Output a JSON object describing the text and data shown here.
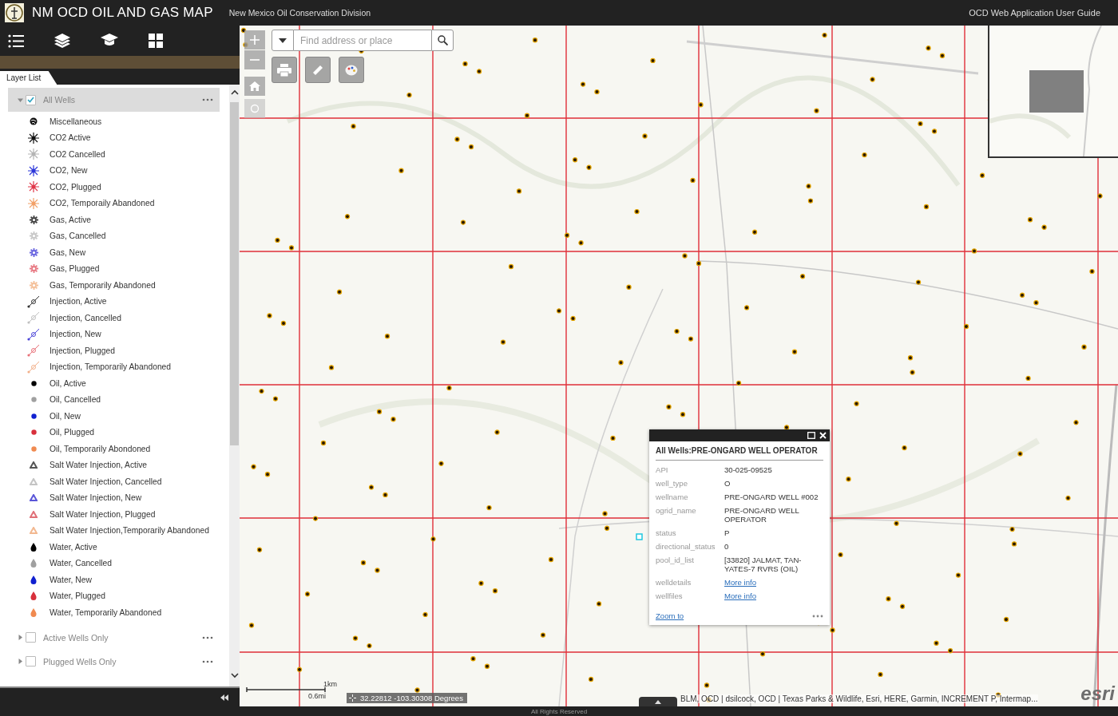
{
  "header": {
    "title": "NM OCD OIL AND GAS MAP",
    "subtitle": "New Mexico Oil Conservation Division",
    "guide_link": "OCD Web Application User Guide"
  },
  "panel": {
    "tab": "Layer List",
    "groups": [
      {
        "label": "All Wells",
        "checked": true,
        "expanded": true,
        "selected": true,
        "legend": [
          {
            "label": "Miscellaneous",
            "kind": "misc",
            "color": "#111111"
          },
          {
            "label": "CO2 Active",
            "kind": "co2",
            "color": "#111111"
          },
          {
            "label": "CO2 Cancelled",
            "kind": "co2",
            "color": "#b4b4b4"
          },
          {
            "label": "CO2, New",
            "kind": "co2",
            "color": "#2b36d9"
          },
          {
            "label": "CO2, Plugged",
            "kind": "co2",
            "color": "#e0384a"
          },
          {
            "label": "CO2, Temporaily Abandoned",
            "kind": "co2",
            "color": "#f2a067"
          },
          {
            "label": "Gas, Active",
            "kind": "gas",
            "color": "#444444"
          },
          {
            "label": "Gas, Cancelled",
            "kind": "gas",
            "color": "#c8c8c8"
          },
          {
            "label": "Gas, New",
            "kind": "gas",
            "color": "#6a66e0"
          },
          {
            "label": "Gas, Plugged",
            "kind": "gas",
            "color": "#e87a84"
          },
          {
            "label": "Gas, Temporarily Abandoned",
            "kind": "gas",
            "color": "#f4c09a"
          },
          {
            "label": "Injection, Active",
            "kind": "injection",
            "color": "#333333"
          },
          {
            "label": "Injection, Cancelled",
            "kind": "injection",
            "color": "#c0c0c0"
          },
          {
            "label": "Injection, New",
            "kind": "injection",
            "color": "#4a44d8"
          },
          {
            "label": "Injection, Plugged",
            "kind": "injection",
            "color": "#e87078"
          },
          {
            "label": "Injection, Temporarily Abandoned",
            "kind": "injection",
            "color": "#f2b08a"
          },
          {
            "label": "Oil, Active",
            "kind": "oil",
            "color": "#000000"
          },
          {
            "label": "Oil, Cancelled",
            "kind": "oil",
            "color": "#a0a0a0"
          },
          {
            "label": "Oil, New",
            "kind": "oil",
            "color": "#1020d0"
          },
          {
            "label": "Oil, Plugged",
            "kind": "oil",
            "color": "#d8303c"
          },
          {
            "label": "Oil, Temporarily Abondoned",
            "kind": "oil",
            "color": "#f08a50"
          },
          {
            "label": "Salt Water Injection, Active",
            "kind": "swi",
            "color": "#555555"
          },
          {
            "label": "Salt Water Injection, Cancelled",
            "kind": "swi",
            "color": "#c4c4c4"
          },
          {
            "label": "Salt Water Injection, New",
            "kind": "swi",
            "color": "#5a56d8"
          },
          {
            "label": "Salt Water Injection, Plugged",
            "kind": "swi",
            "color": "#e07078"
          },
          {
            "label": "Salt Water Injection,Temporarily Abandoned",
            "kind": "swi",
            "color": "#f2b890"
          },
          {
            "label": "Water, Active",
            "kind": "water",
            "color": "#000000"
          },
          {
            "label": "Water, Cancelled",
            "kind": "water",
            "color": "#a0a0a0"
          },
          {
            "label": "Water, New",
            "kind": "water",
            "color": "#1020d0"
          },
          {
            "label": "Water, Plugged",
            "kind": "water",
            "color": "#d8303c"
          },
          {
            "label": "Water, Temporarily Abandoned",
            "kind": "water",
            "color": "#f08a50"
          }
        ]
      },
      {
        "label": "Active Wells Only",
        "checked": false,
        "expanded": false,
        "selected": false
      },
      {
        "label": "Plugged Wells Only",
        "checked": false,
        "expanded": false,
        "selected": false
      }
    ]
  },
  "map": {
    "search": {
      "placeholder": "Find address or place"
    },
    "scale": {
      "metric": "1km",
      "imperial": "0.6mi"
    },
    "coordinates": "32.22812 -103.30308 Degrees",
    "attribution": "BLM, OCD | dsilcock, OCD | Texas Parks & Wildlife, Esri, HERE, Garmin, INCREMENT P, Intermap...",
    "logo": "esri",
    "popup": {
      "title": "All Wells:PRE-ONGARD WELL OPERATOR",
      "fields": [
        {
          "name": "API",
          "value": "30-025-09525",
          "kind": "text"
        },
        {
          "name": "well_type",
          "value": "O",
          "kind": "text"
        },
        {
          "name": "wellname",
          "value": "PRE-ONGARD WELL #002",
          "kind": "text"
        },
        {
          "name": "ogrid_name",
          "value": "PRE-ONGARD WELL OPERATOR",
          "kind": "text"
        },
        {
          "name": "status",
          "value": "P",
          "kind": "text"
        },
        {
          "name": "directional_status",
          "value": "0",
          "kind": "text"
        },
        {
          "name": "pool_id_list",
          "value": "[33820] JALMAT, TAN-YATES-7 RVRS (OIL)",
          "kind": "text"
        },
        {
          "name": "welldetails",
          "value": "More info",
          "kind": "link"
        },
        {
          "name": "wellfiles",
          "value": "More info",
          "kind": "link"
        }
      ],
      "zoom_link": "Zoom to"
    }
  },
  "footer": "All Rights Reserved"
}
